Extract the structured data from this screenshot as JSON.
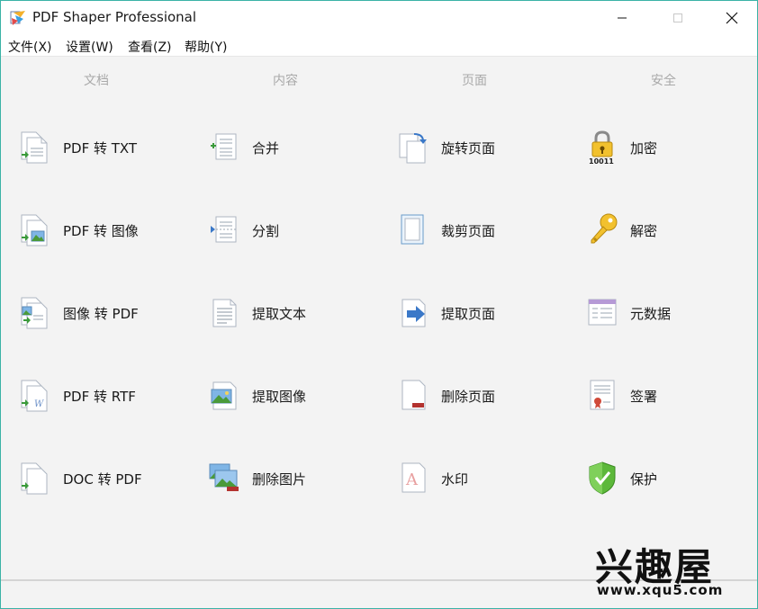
{
  "window": {
    "title": "PDF Shaper Professional"
  },
  "menu": [
    "文件(X)",
    "设置(W)",
    "查看(Z)",
    "帮助(Y)"
  ],
  "categories": [
    "文档",
    "内容",
    "页面",
    "安全"
  ],
  "tools": {
    "document": [
      "PDF 转 TXT",
      "PDF 转 图像",
      "图像 转 PDF",
      "PDF 转 RTF",
      "DOC 转 PDF"
    ],
    "content": [
      "合并",
      "分割",
      "提取文本",
      "提取图像",
      "删除图片"
    ],
    "pages": [
      "旋转页面",
      "裁剪页面",
      "提取页面",
      "删除页面",
      "水印"
    ],
    "security": [
      "加密",
      "解密",
      "元数据",
      "签署",
      "保护"
    ]
  },
  "icon_badges": {
    "encrypt_digits": "10011"
  },
  "watermark": {
    "brand": "兴趣屋",
    "url": "www.xqu5.com"
  }
}
